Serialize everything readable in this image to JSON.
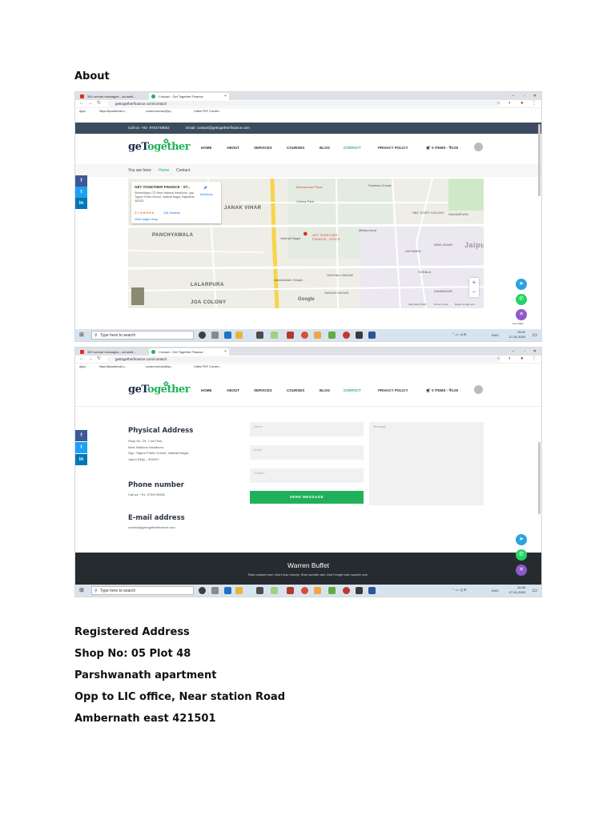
{
  "doc": {
    "heading": "About",
    "address": {
      "title": "Registered Address",
      "line1": "Shop No: 05 Plot 48",
      "line2": "Parshwanath apartment",
      "line3": "Opp to LIC office, Near station Road",
      "line4": "Ambernath east 421501"
    }
  },
  "browser": {
    "tab1": "300 unread messages - sonam8...",
    "tab2": "Contact - Get Together Finance",
    "url": "gettogetherfinance.com/contact/",
    "bookmarks": [
      "Apps",
      "https://tipswebmail.c...",
      "sonam.humvan@sy...",
      "Online PDF Convert..."
    ]
  },
  "site": {
    "call": "Call us: +91- 9704749552",
    "email": "Email: contact@gettogetherfinance.com",
    "logo_main": "geT",
    "logo_accent": "ogether",
    "menu": [
      "HOME",
      "ABOUT",
      "SERVICES",
      "COURSES",
      "BLOG",
      "CONTACT",
      "PRIVACY POLICY"
    ],
    "cart": "0 ITEMS - ₹0.00",
    "breadcrumb_prefix": "You are here:",
    "breadcrumb_home": "Home",
    "breadcrumb_current": "Contact",
    "share": [
      "f",
      "t",
      "in"
    ]
  },
  "map": {
    "card_title": "GET TOGETHER FINANCE - ST...",
    "card_address": "Shreenillaya LTD Near National Handloom, opp. Tagore Public School, Vaishali Nagar, Rajasthan 302021",
    "directions": "Directions",
    "rating": "5.0 ★★★★★",
    "reviews": "116 reviews",
    "larger": "View larger map",
    "pin_label": "GET TOGETHER FINANCE - STOCK",
    "labels": [
      "JANAK VIHAR",
      "Mansarovar Plaza",
      "Colony Park",
      "Fearless Chowk",
      "NBC STAFF COLONY",
      "HASANPURA",
      "PANCHYAWALA",
      "Military Area",
      "NEW DHANI",
      "Jaipur",
      "HATWARA",
      "Vaishali Nagar",
      "LALARPURA",
      "JOA COLONY",
      "VAISHALI NAGAR",
      "SANJAY NAGAR",
      "Akshardham Temple",
      "KAMNAGAR",
      "SODALA",
      "Google",
      "Map data ©2020",
      "Terms of Use",
      "Report a map error"
    ]
  },
  "contact": {
    "physical_title": "Physical Address",
    "physical_lines": [
      "Shop No. 29, 2 nd Floor,",
      "Near National Handloom,",
      "Opp. Tagore Public School, Vaishali Nagar,",
      "Jaipur (Raj) – 302021"
    ],
    "phone_title": "Phone number",
    "phone": "Call us: +91- 9704749552",
    "email_title": "E-mail address",
    "email": "contact@gettogetherfinance.com",
    "name_ph": "Name",
    "email_ph": "Email",
    "subject_ph": "Subject",
    "message_ph": "Message",
    "send": "SEND MESSAGE",
    "quote_author": "Warren Buffet",
    "quote_text": "Rule number one: Don't lose money. Rule number two: Don't forget rule number one."
  },
  "taskbar": {
    "search": "Type here to search",
    "time1": "10:41",
    "time2": "10:46",
    "date": "17-01-2020",
    "lang": "ENG",
    "chat": "Get Chats"
  },
  "colors": {
    "brand_green": "#1fb15a",
    "navy": "#3c4b5e",
    "telegram": "#2aa3e0",
    "whatsapp": "#25d366",
    "close": "#8e59c9",
    "facebook": "#3b5998",
    "twitter": "#1da1f2",
    "linkedin": "#0077b5"
  }
}
